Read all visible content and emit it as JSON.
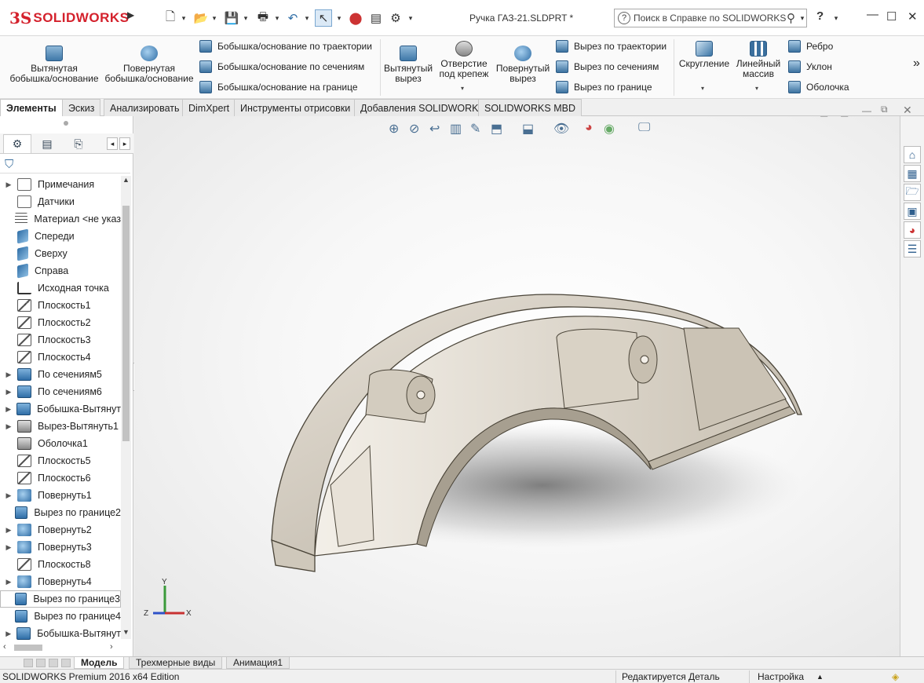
{
  "app": {
    "logo_mark": "3S",
    "logo_text": "SOLIDWORKS",
    "document_title": "Ручка ГАЗ-21.SLDPRT *",
    "help_search_placeholder": "Поиск в Справке по SOLIDWORKS",
    "help_button": "?"
  },
  "quick_access": [
    "new-icon",
    "open-icon",
    "save-icon",
    "print-icon",
    "undo-icon",
    "select-icon",
    "rebuild-icon",
    "file-properties-icon",
    "options-icon"
  ],
  "command_manager": {
    "large": [
      {
        "label": "Вытянутая бобышка/основание",
        "icon": "extruded-boss-icon"
      },
      {
        "label": "Повернутая бобышка/основание",
        "icon": "revolved-boss-icon"
      },
      {
        "label": "Вытянутый вырез",
        "icon": "extruded-cut-icon"
      },
      {
        "label": "Отверстие под крепеж",
        "icon": "hole-wizard-icon"
      },
      {
        "label": "Повернутый вырез",
        "icon": "revolved-cut-icon"
      },
      {
        "label": "Скругление",
        "icon": "fillet-icon"
      },
      {
        "label": "Линейный массив",
        "icon": "linear-pattern-icon"
      }
    ],
    "boss_small": [
      {
        "label": "Бобышка/основание по траектории",
        "icon": "swept-boss-icon"
      },
      {
        "label": "Бобышка/основание по сечениям",
        "icon": "lofted-boss-icon"
      },
      {
        "label": "Бобышка/основание на границе",
        "icon": "boundary-boss-icon"
      }
    ],
    "cut_small": [
      {
        "label": "Вырез по траектории",
        "icon": "swept-cut-icon"
      },
      {
        "label": "Вырез по сечениям",
        "icon": "lofted-cut-icon"
      },
      {
        "label": "Вырез по границе",
        "icon": "boundary-cut-icon"
      }
    ],
    "features_small": [
      {
        "label": "Ребро",
        "icon": "rib-icon"
      },
      {
        "label": "Уклон",
        "icon": "draft-icon"
      },
      {
        "label": "Оболочка",
        "icon": "shell-icon"
      }
    ],
    "more": "»"
  },
  "tabs": [
    "Элементы",
    "Эскиз",
    "Анализировать",
    "DimXpert",
    "Инструменты отрисовки",
    "Добавления SOLIDWORKS",
    "SOLIDWORKS MBD"
  ],
  "feature_tree": [
    {
      "label": "Примечания",
      "icon": "annotations-icon",
      "expandable": true
    },
    {
      "label": "Датчики",
      "icon": "sensors-icon",
      "expandable": false
    },
    {
      "label": "Материал <не указ",
      "icon": "material-icon",
      "expandable": false
    },
    {
      "label": "Спереди",
      "icon": "plane-icon",
      "expandable": false
    },
    {
      "label": "Сверху",
      "icon": "plane-icon",
      "expandable": false
    },
    {
      "label": "Справа",
      "icon": "plane-icon",
      "expandable": false
    },
    {
      "label": "Исходная точка",
      "icon": "origin-icon",
      "expandable": false
    },
    {
      "label": "Плоскость1",
      "icon": "ref-plane-icon",
      "expandable": false
    },
    {
      "label": "Плоскость2",
      "icon": "ref-plane-icon",
      "expandable": false
    },
    {
      "label": "Плоскость3",
      "icon": "ref-plane-icon",
      "expandable": false
    },
    {
      "label": "Плоскость4",
      "icon": "ref-plane-icon",
      "expandable": false
    },
    {
      "label": "По сечениям5",
      "icon": "loft-icon",
      "expandable": true
    },
    {
      "label": "По сечениям6",
      "icon": "loft-icon",
      "expandable": true
    },
    {
      "label": "Бобышка-Вытянут",
      "icon": "extrude-icon",
      "expandable": true
    },
    {
      "label": "Вырез-Вытянуть1",
      "icon": "cut-icon",
      "expandable": true
    },
    {
      "label": "Оболочка1",
      "icon": "shell-icon",
      "expandable": false
    },
    {
      "label": "Плоскость5",
      "icon": "ref-plane-icon",
      "expandable": false
    },
    {
      "label": "Плоскость6",
      "icon": "ref-plane-icon",
      "expandable": false
    },
    {
      "label": "Повернуть1",
      "icon": "revolve-icon",
      "expandable": true
    },
    {
      "label": "Вырез по границе2",
      "icon": "boundary-cut-icon",
      "expandable": false
    },
    {
      "label": "Повернуть2",
      "icon": "revolve-icon",
      "expandable": true
    },
    {
      "label": "Повернуть3",
      "icon": "revolve-icon",
      "expandable": true
    },
    {
      "label": "Плоскость8",
      "icon": "ref-plane-icon",
      "expandable": false
    },
    {
      "label": "Повернуть4",
      "icon": "revolve-icon",
      "expandable": true
    },
    {
      "label": "Вырез по границе3",
      "icon": "boundary-cut-icon",
      "expandable": false,
      "selected": true
    },
    {
      "label": "Вырез по границе4",
      "icon": "boundary-cut-icon",
      "expandable": false
    },
    {
      "label": "Бобышка-Вытянут",
      "icon": "extrude-icon",
      "expandable": true
    }
  ],
  "triad": {
    "y": "Y",
    "x": "X",
    "z": "Z"
  },
  "bottom_tabs": [
    "Модель",
    "Трехмерные виды",
    "Анимация1"
  ],
  "status": {
    "edition": "SOLIDWORKS Premium 2016 x64 Edition",
    "mode": "Редактируется Деталь",
    "units": "Настройка"
  }
}
